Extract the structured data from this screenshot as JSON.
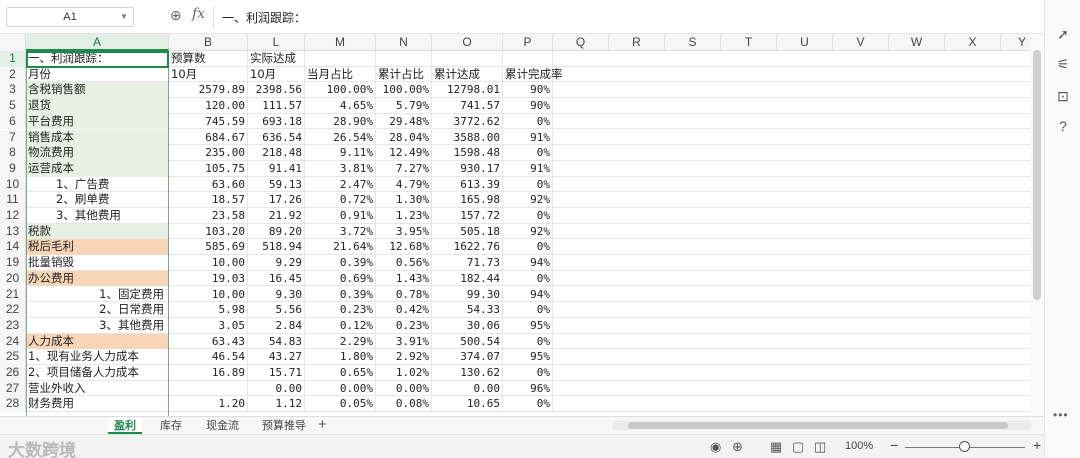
{
  "formula_bar": {
    "cell_ref": "A1",
    "fx_label": "fx",
    "content": "一、利润跟踪："
  },
  "columns": [
    "A",
    "B",
    "L",
    "M",
    "N",
    "O",
    "P",
    "Q",
    "R",
    "S",
    "T",
    "U",
    "V",
    "W",
    "X",
    "Y"
  ],
  "rows": [
    {
      "num": "1",
      "cells": [
        "一、利润跟踪：",
        "预算数",
        "实际达成",
        "",
        "",
        "",
        ""
      ]
    },
    {
      "num": "2",
      "cells": [
        "月份",
        "10月",
        "10月",
        "当月占比",
        "累计占比",
        "累计达成",
        "累计完成率"
      ]
    },
    {
      "num": "3",
      "cells": [
        "含税销售额",
        "2579.89",
        "2398.56",
        "100.00%",
        "100.00%",
        "12798.01",
        "90%"
      ]
    },
    {
      "num": "5",
      "cells": [
        "退货",
        "120.00",
        "111.57",
        "4.65%",
        "5.79%",
        "741.57",
        "90%"
      ]
    },
    {
      "num": "6",
      "cells": [
        "平台费用",
        "745.59",
        "693.18",
        "28.90%",
        "29.48%",
        "3772.62",
        "0%"
      ]
    },
    {
      "num": "7",
      "cells": [
        "销售成本",
        "684.67",
        "636.54",
        "26.54%",
        "28.04%",
        "3588.00",
        "91%"
      ]
    },
    {
      "num": "8",
      "cells": [
        "物流费用",
        "235.00",
        "218.48",
        "9.11%",
        "12.49%",
        "1598.48",
        "0%"
      ]
    },
    {
      "num": "9",
      "cells": [
        "运营成本",
        "105.75",
        "91.41",
        "3.81%",
        "7.27%",
        "930.17",
        "91%"
      ]
    },
    {
      "num": "10",
      "cells": [
        "1、广告费",
        "63.60",
        "59.13",
        "2.47%",
        "4.79%",
        "613.39",
        "0%"
      ]
    },
    {
      "num": "11",
      "cells": [
        "2、刷单费",
        "18.57",
        "17.26",
        "0.72%",
        "1.30%",
        "165.98",
        "92%"
      ]
    },
    {
      "num": "12",
      "cells": [
        "3、其他费用",
        "23.58",
        "21.92",
        "0.91%",
        "1.23%",
        "157.72",
        "0%"
      ]
    },
    {
      "num": "13",
      "cells": [
        "税款",
        "103.20",
        "89.20",
        "3.72%",
        "3.95%",
        "505.18",
        "92%"
      ]
    },
    {
      "num": "14",
      "cells": [
        "税后毛利",
        "585.69",
        "518.94",
        "21.64%",
        "12.68%",
        "1622.76",
        "0%"
      ]
    },
    {
      "num": "19",
      "cells": [
        "批量销毁",
        "10.00",
        "9.29",
        "0.39%",
        "0.56%",
        "71.73",
        "94%"
      ]
    },
    {
      "num": "20",
      "cells": [
        "办公费用",
        "19.03",
        "16.45",
        "0.69%",
        "1.43%",
        "182.44",
        "0%"
      ]
    },
    {
      "num": "21",
      "cells": [
        "1、固定费用",
        "10.00",
        "9.30",
        "0.39%",
        "0.78%",
        "99.30",
        "94%"
      ]
    },
    {
      "num": "22",
      "cells": [
        "2、日常费用",
        "5.98",
        "5.56",
        "0.23%",
        "0.42%",
        "54.33",
        "0%"
      ]
    },
    {
      "num": "23",
      "cells": [
        "3、其他费用",
        "3.05",
        "2.84",
        "0.12%",
        "0.23%",
        "30.06",
        "95%"
      ]
    },
    {
      "num": "24",
      "cells": [
        "人力成本",
        "63.43",
        "54.83",
        "2.29%",
        "3.91%",
        "500.54",
        "0%"
      ]
    },
    {
      "num": "25",
      "cells": [
        "1、现有业务人力成本",
        "46.54",
        "43.27",
        "1.80%",
        "2.92%",
        "374.07",
        "95%"
      ]
    },
    {
      "num": "26",
      "cells": [
        "2、项目储备人力成本",
        "16.89",
        "15.71",
        "0.65%",
        "1.02%",
        "130.62",
        "0%"
      ]
    },
    {
      "num": "27",
      "cells": [
        "营业外收入",
        "",
        "0.00",
        "0.00%",
        "0.00%",
        "0.00",
        "96%"
      ]
    },
    {
      "num": "28",
      "cells": [
        "财务费用",
        "1.20",
        "1.12",
        "0.05%",
        "0.08%",
        "10.65",
        "0%"
      ]
    }
  ],
  "sheet_tabs": [
    "盈利",
    "库存",
    "现金流",
    "预算推导"
  ],
  "active_sheet": "盈利",
  "status": {
    "zoom": "100%",
    "watermark": "大数跨境"
  },
  "colors": {
    "accent": "#1e8a4c",
    "green_fill": "#e8f0e4",
    "orange_fill": "#f9d5b8"
  }
}
